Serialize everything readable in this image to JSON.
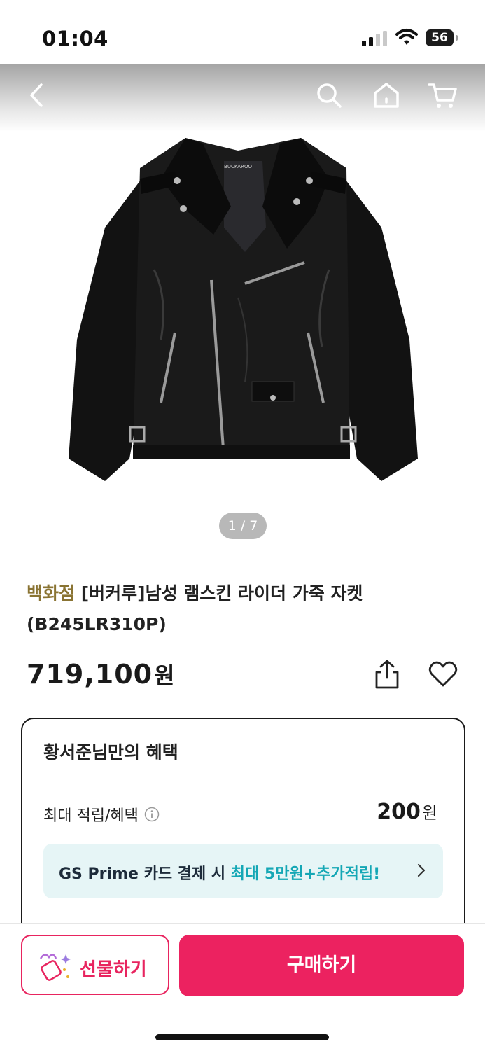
{
  "status_bar": {
    "time": "01:04",
    "battery": "56"
  },
  "nav": {
    "icons": [
      "back-icon",
      "search-icon",
      "home-icon",
      "cart-icon"
    ]
  },
  "gallery": {
    "brand_label": "BUCKAROO",
    "pager": "1 / 7"
  },
  "product": {
    "store_label": "백화점",
    "title_rest": "[버커루]남성 램스킨 라이더 가죽 자켓",
    "title_line2": "(B245LR310P)",
    "price": "719,100",
    "price_unit": "원"
  },
  "benefits": {
    "heading": "황서준님만의 혜택",
    "reward_label": "최대 적립/혜택",
    "reward_value": "200",
    "reward_unit": "원",
    "promo_prefix": "GS Prime 카드 결제 시 ",
    "promo_highlight": "최대 5만원+추가적립!"
  },
  "actions": {
    "gift_label": "선물하기",
    "buy_label": "구매하기"
  },
  "colors": {
    "accent": "#ec2260",
    "store_label": "#8a7433",
    "promo_highlight": "#14a7b5",
    "promo_bg": "#e6f5f6"
  }
}
